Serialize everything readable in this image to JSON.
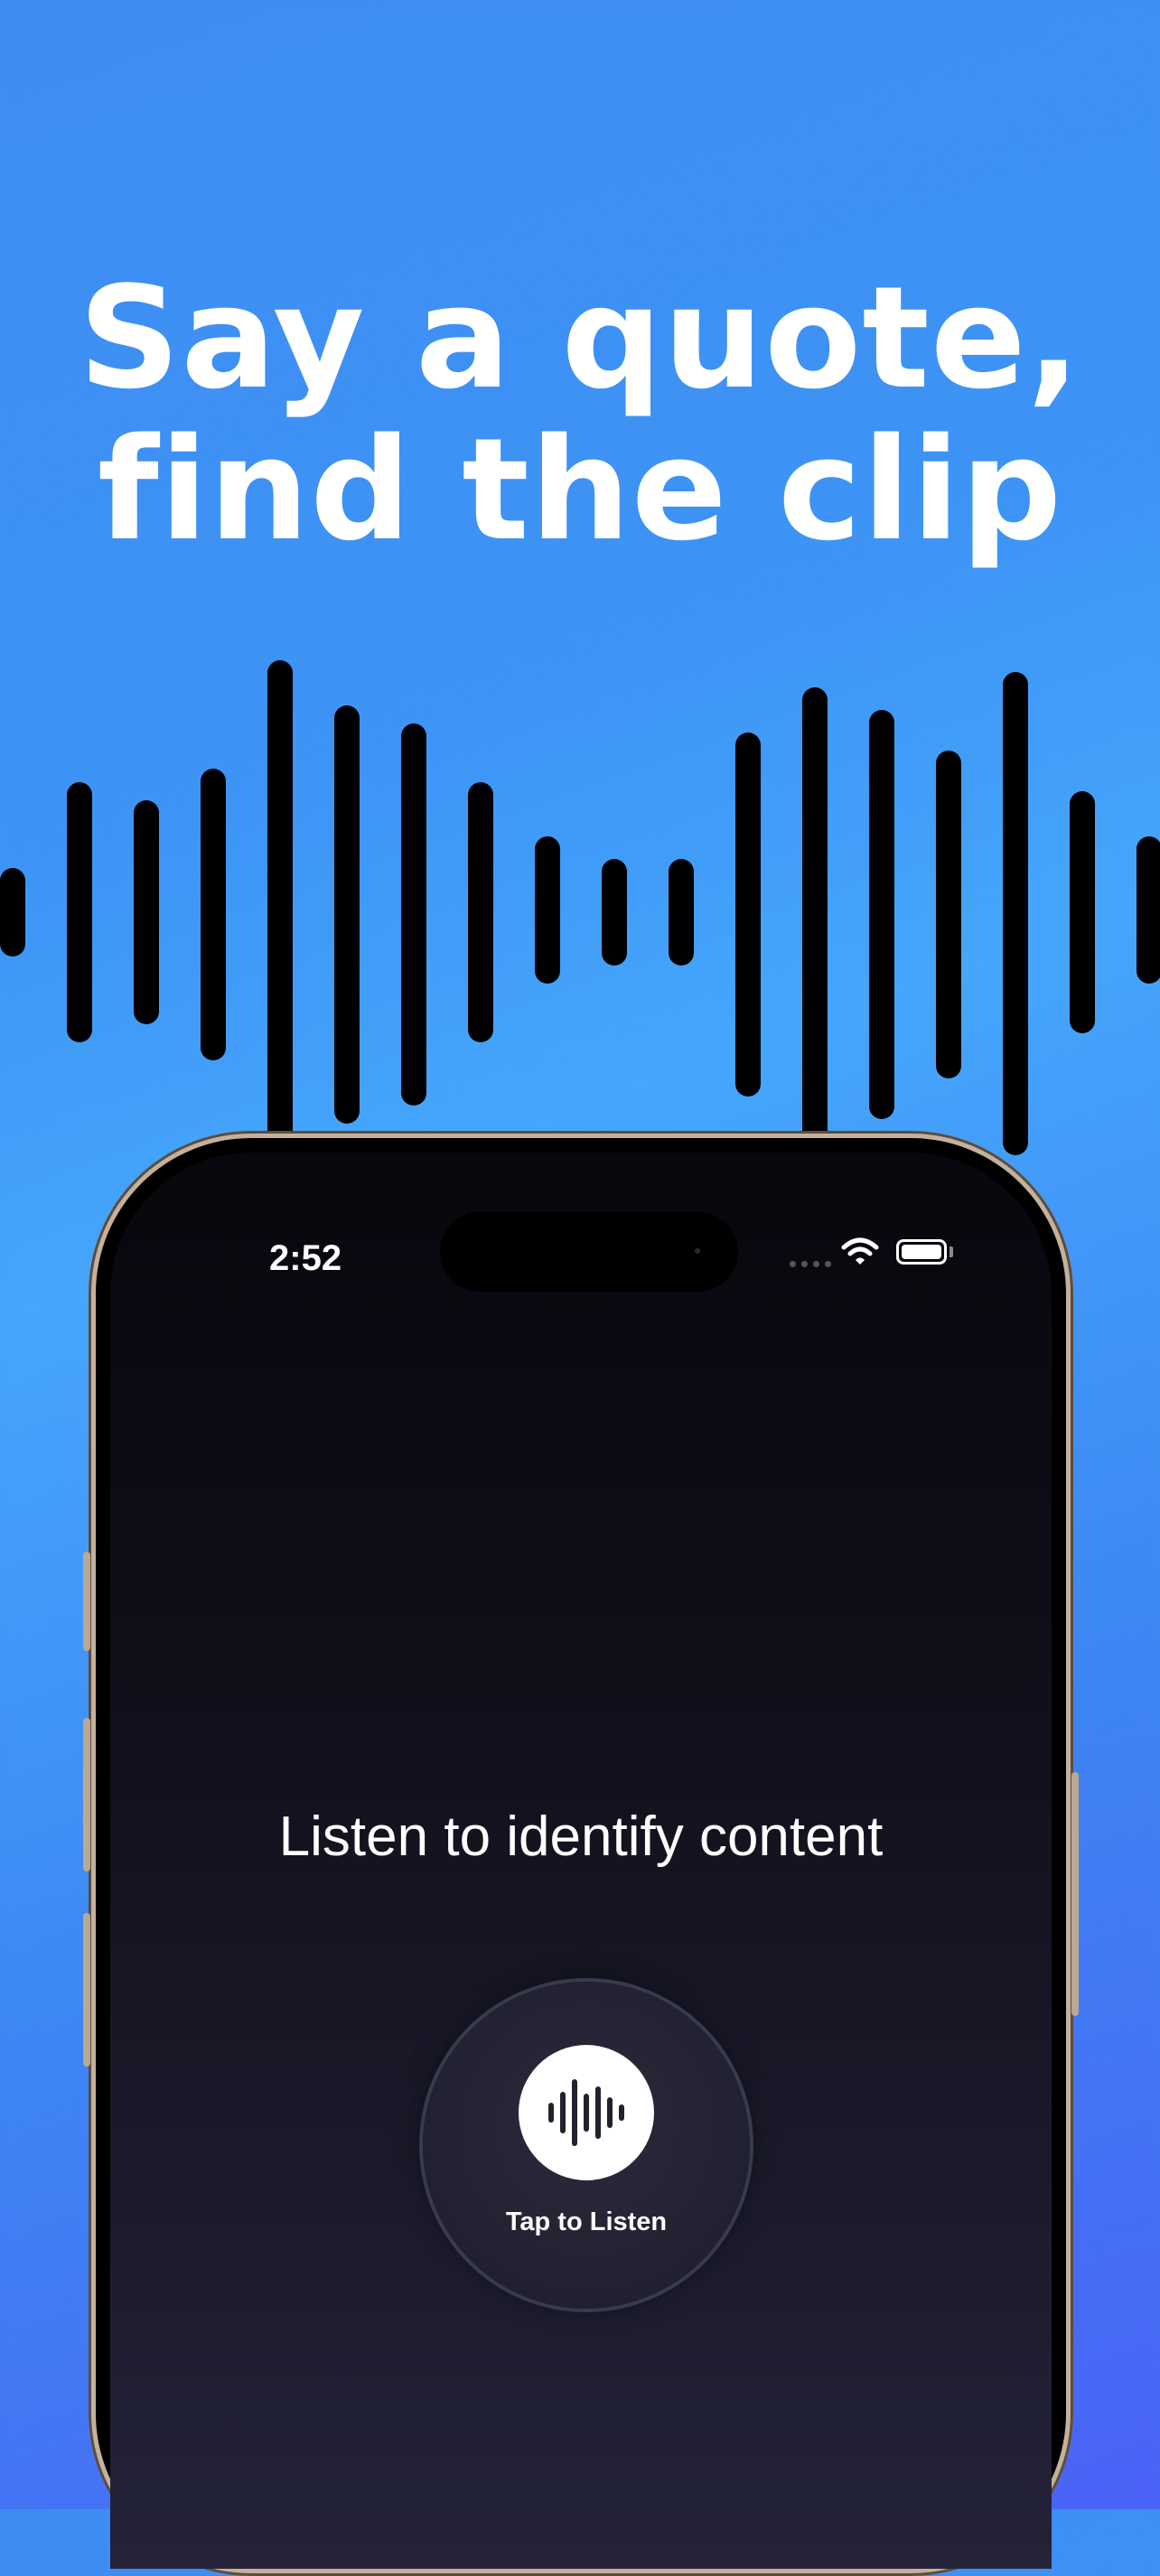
{
  "headline": {
    "line1": "Say a quote,",
    "line2": "find the clip"
  },
  "status_bar": {
    "time": "2:52"
  },
  "app": {
    "prompt": "Listen to identify content",
    "listen_button_label": "Tap to Listen"
  },
  "colors": {
    "background_top": "#3f8cf2",
    "background_bottom": "#4a62f6",
    "screen_dark": "#0f0f1a",
    "waveform_bars": "#000000",
    "text": "#ffffff"
  },
  "icons": [
    "waveform-icon",
    "wifi-icon",
    "battery-icon",
    "cellular-signal-icon"
  ]
}
